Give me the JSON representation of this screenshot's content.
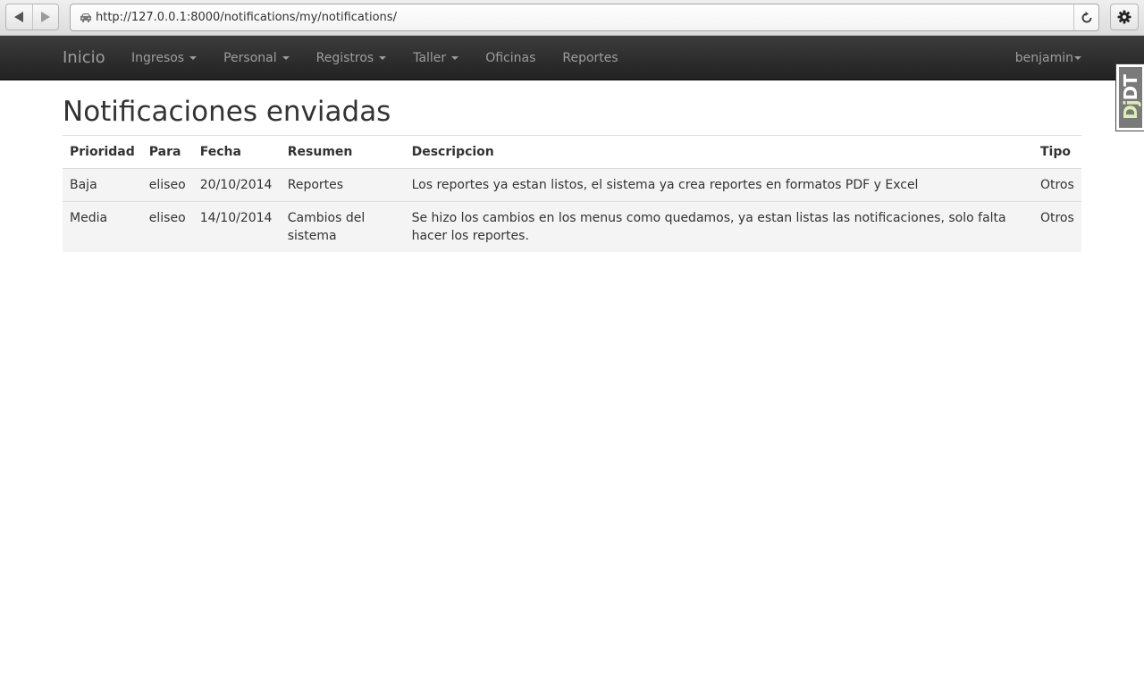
{
  "browser": {
    "url": "http://127.0.0.1:8000/notifications/my/notifications/"
  },
  "navbar": {
    "brand": "Inicio",
    "items": [
      {
        "label": "Ingresos",
        "dropdown": true
      },
      {
        "label": "Personal",
        "dropdown": true
      },
      {
        "label": "Registros",
        "dropdown": true
      },
      {
        "label": "Taller",
        "dropdown": true
      },
      {
        "label": "Oficinas",
        "dropdown": false
      },
      {
        "label": "Reportes",
        "dropdown": false
      }
    ],
    "user": "benjamin"
  },
  "debug_toolbar": {
    "label_dj": "Dj",
    "label_dt": "DT"
  },
  "page": {
    "title": "Notificaciones enviadas",
    "table": {
      "headers": [
        "Prioridad",
        "Para",
        "Fecha",
        "Resumen",
        "Descripcion",
        "Tipo"
      ],
      "rows": [
        [
          "Baja",
          "eliseo",
          "20/10/2014",
          "Reportes",
          "Los reportes ya estan listos, el sistema ya crea reportes en formatos PDF y Excel",
          "Otros"
        ],
        [
          "Media",
          "eliseo",
          "14/10/2014",
          "Cambios del sistema",
          "Se hizo los cambios en los menus como quedamos, ya estan listas las notificaciones, solo falta hacer los reportes.",
          "Otros"
        ]
      ]
    }
  },
  "colors": {
    "navbar_top": "#3c3c3c",
    "navbar_bottom": "#222222",
    "nav_text": "#9d9d9d",
    "text": "#333333",
    "row_bg": "#f4f4f4"
  }
}
